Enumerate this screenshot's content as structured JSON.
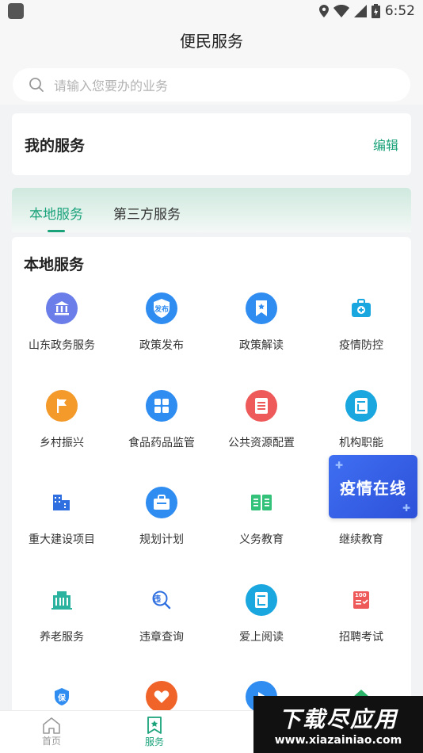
{
  "status_bar": {
    "time": "6:52"
  },
  "header": {
    "title": "便民服务"
  },
  "search": {
    "placeholder": "请输入您要办的业务"
  },
  "my_services": {
    "title": "我的服务",
    "edit_label": "编辑"
  },
  "tabs": [
    {
      "label": "本地服务",
      "active": true
    },
    {
      "label": "第三方服务",
      "active": false
    }
  ],
  "panel": {
    "title": "本地服务"
  },
  "services": [
    {
      "label": "山东政务服务",
      "icon": "government-building-icon",
      "color": "#6a7de8"
    },
    {
      "label": "政策发布",
      "icon": "policy-publish-shield-icon",
      "color": "#2f8cf0",
      "icon_text": "发布"
    },
    {
      "label": "政策解读",
      "icon": "bookmark-star-icon",
      "color": "#2f8cf0"
    },
    {
      "label": "疫情防控",
      "icon": "medical-kit-icon",
      "color": "#1aa7e0"
    },
    {
      "label": "乡村振兴",
      "icon": "flag-icon",
      "color": "#f39a2a"
    },
    {
      "label": "食品药品监管",
      "icon": "grid-apps-icon",
      "color": "#2f8cf0"
    },
    {
      "label": "公共资源配置",
      "icon": "document-list-icon",
      "color": "#ee5a5a"
    },
    {
      "label": "机构职能",
      "icon": "book-page-icon",
      "color": "#1aa7e0"
    },
    {
      "label": "重大建设项目",
      "icon": "buildings-icon",
      "color": "#2f6fe0"
    },
    {
      "label": "规划计划",
      "icon": "briefcase-icon",
      "color": "#2f8cf0"
    },
    {
      "label": "义务教育",
      "icon": "open-book-icon",
      "color": "#34c27a"
    },
    {
      "label": "继续教育",
      "icon": "continuing-education-icon",
      "color": "#2f8cf0"
    },
    {
      "label": "养老服务",
      "icon": "elder-care-building-icon",
      "color": "#2bb3a0"
    },
    {
      "label": "违章查询",
      "icon": "violation-search-icon",
      "color": "#2f6fe0",
      "icon_text": "违"
    },
    {
      "label": "爱上阅读",
      "icon": "reading-book-icon",
      "color": "#1aa7e0"
    },
    {
      "label": "招聘考试",
      "icon": "exam-paper-icon",
      "color": "#ee5a5a",
      "icon_text": "100"
    },
    {
      "label": "",
      "icon": "insurance-shield-icon",
      "color": "#2f8cf0",
      "icon_text": "保"
    },
    {
      "label": "",
      "icon": "tag-heart-icon",
      "color": "#f0642a"
    },
    {
      "label": "",
      "icon": "video-play-icon",
      "color": "#2f8cf0"
    },
    {
      "label": "",
      "icon": "house-icon",
      "color": "#2bb36a"
    }
  ],
  "floating_banner": {
    "text": "疫情在线"
  },
  "bottom_nav": [
    {
      "label": "首页",
      "icon": "home-icon",
      "active": false
    },
    {
      "label": "服务",
      "icon": "service-bookmark-icon",
      "active": true
    }
  ],
  "watermark": {
    "title": "下载尽应用",
    "url": "www.xiazainiao.com"
  },
  "colors": {
    "accent": "#1aa27a",
    "background": "#f2f3f5"
  }
}
